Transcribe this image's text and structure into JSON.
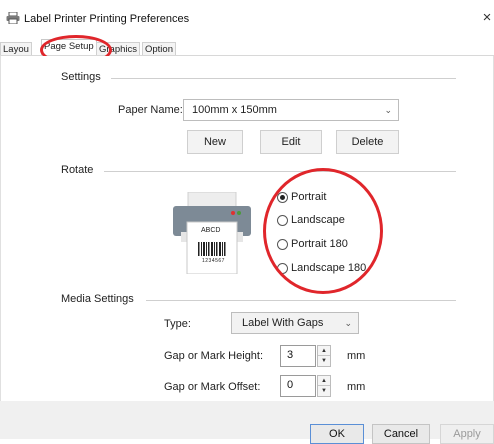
{
  "window": {
    "title": "Label Printer Printing Preferences",
    "close_glyph": "×"
  },
  "tabs": [
    {
      "label": "Layout",
      "visible_text": "Layou"
    },
    {
      "label": "Page Setup"
    },
    {
      "label": "Graphics"
    },
    {
      "label": "Option"
    }
  ],
  "settings": {
    "group_label": "Settings",
    "paper_label": "Paper Name:",
    "paper_value": "100mm x 150mm",
    "new_label": "New",
    "edit_label": "Edit",
    "delete_label": "Delete"
  },
  "rotate": {
    "group_label": "Rotate",
    "printer_label_text": "ABCD",
    "printer_barcode_number": "1234567",
    "options": [
      {
        "label": "Portrait",
        "checked": true
      },
      {
        "label": "Landscape",
        "checked": false
      },
      {
        "label": "Portrait 180",
        "checked": false
      },
      {
        "label": "Landscape 180",
        "checked": false
      }
    ]
  },
  "media": {
    "group_label": "Media Settings",
    "type_label": "Type:",
    "type_value": "Label With Gaps",
    "gap_height_label": "Gap or Mark Height:",
    "gap_height_value": "3",
    "gap_height_unit": "mm",
    "gap_offset_label": "Gap or Mark Offset:",
    "gap_offset_value": "0",
    "gap_offset_unit": "mm"
  },
  "footer": {
    "ok_label": "OK",
    "cancel_label": "Cancel",
    "apply_label": "Apply"
  },
  "colors": {
    "annotation_red": "#e0262b",
    "highlight_yellow": "#ffc83c"
  }
}
